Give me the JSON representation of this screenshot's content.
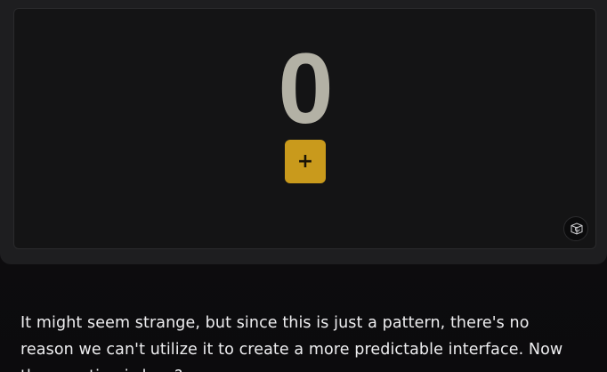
{
  "demo": {
    "counter_value": "0",
    "increment_label": "+",
    "increment_color": "#c99a1c",
    "reset_icon": "refresh-cube-icon"
  },
  "article": {
    "paragraph_text": "It might seem strange, but since this is just a pattern, there's no reason we can't utilize it to create a more predictable interface. Now the question is how?"
  }
}
